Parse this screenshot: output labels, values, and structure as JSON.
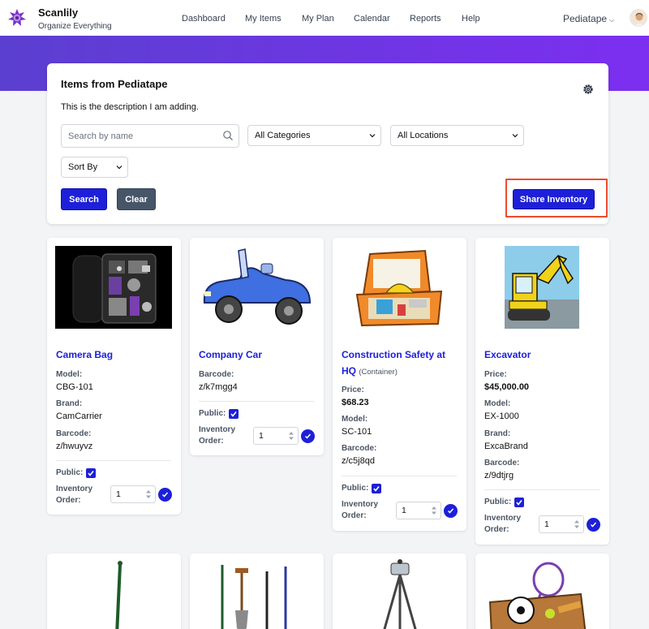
{
  "header": {
    "brand": "Scanlily",
    "tagline": "Organize Everything",
    "nav": [
      "Dashboard",
      "My Items",
      "My Plan",
      "Calendar",
      "Reports",
      "Help"
    ],
    "account": "Pediatape",
    "accent": "#1d20d8"
  },
  "panel": {
    "title": "Items from Pediatape",
    "description": "This is the description I am adding.",
    "search_placeholder": "Search by name",
    "category_select": "All Categories",
    "location_select": "All Locations",
    "sort_select": "Sort By",
    "search_button": "Search",
    "clear_button": "Clear",
    "share_button": "Share Inventory"
  },
  "items": [
    {
      "name": "Camera Bag",
      "tag": "",
      "fields": [
        {
          "label": "Model:",
          "value": "CBG-101"
        },
        {
          "label": "Brand:",
          "value": "CamCarrier"
        },
        {
          "label": "Barcode:",
          "value": "z/hwuyvz"
        }
      ],
      "public_label": "Public:",
      "inventory_label": "Inventory Order:",
      "inventory_label_1": "Inventory",
      "inventory_label_2": "Order:",
      "order": "1"
    },
    {
      "name": "Company Car",
      "tag": "",
      "fields": [
        {
          "label": "Barcode:",
          "value": "z/k7mgg4"
        }
      ],
      "public_label": "Public:",
      "inventory_label_1": "Inventory",
      "inventory_label_2": "Order:",
      "order": "1"
    },
    {
      "name_line1": "Construction Safety at",
      "name_line2": "HQ",
      "tag": "(Container)",
      "fields": [
        {
          "label": "Price:",
          "value": "$68.23"
        },
        {
          "label": "Model:",
          "value": "SC-101"
        },
        {
          "label": "Barcode:",
          "value": "z/c5j8qd"
        }
      ],
      "public_label": "Public:",
      "inventory_label_1": "Inventory",
      "inventory_label_2": "Order:",
      "order": "1"
    },
    {
      "name": "Excavator",
      "tag": "",
      "fields": [
        {
          "label": "Price:",
          "value": "$45,000.00"
        },
        {
          "label": "Model:",
          "value": "EX-1000"
        },
        {
          "label": "Brand:",
          "value": "ExcaBrand"
        },
        {
          "label": "Barcode:",
          "value": "z/9dtjrg"
        }
      ],
      "public_label": "Public:",
      "inventory_label_1": "Inventory",
      "inventory_label_2": "Order:",
      "order": "1"
    }
  ]
}
